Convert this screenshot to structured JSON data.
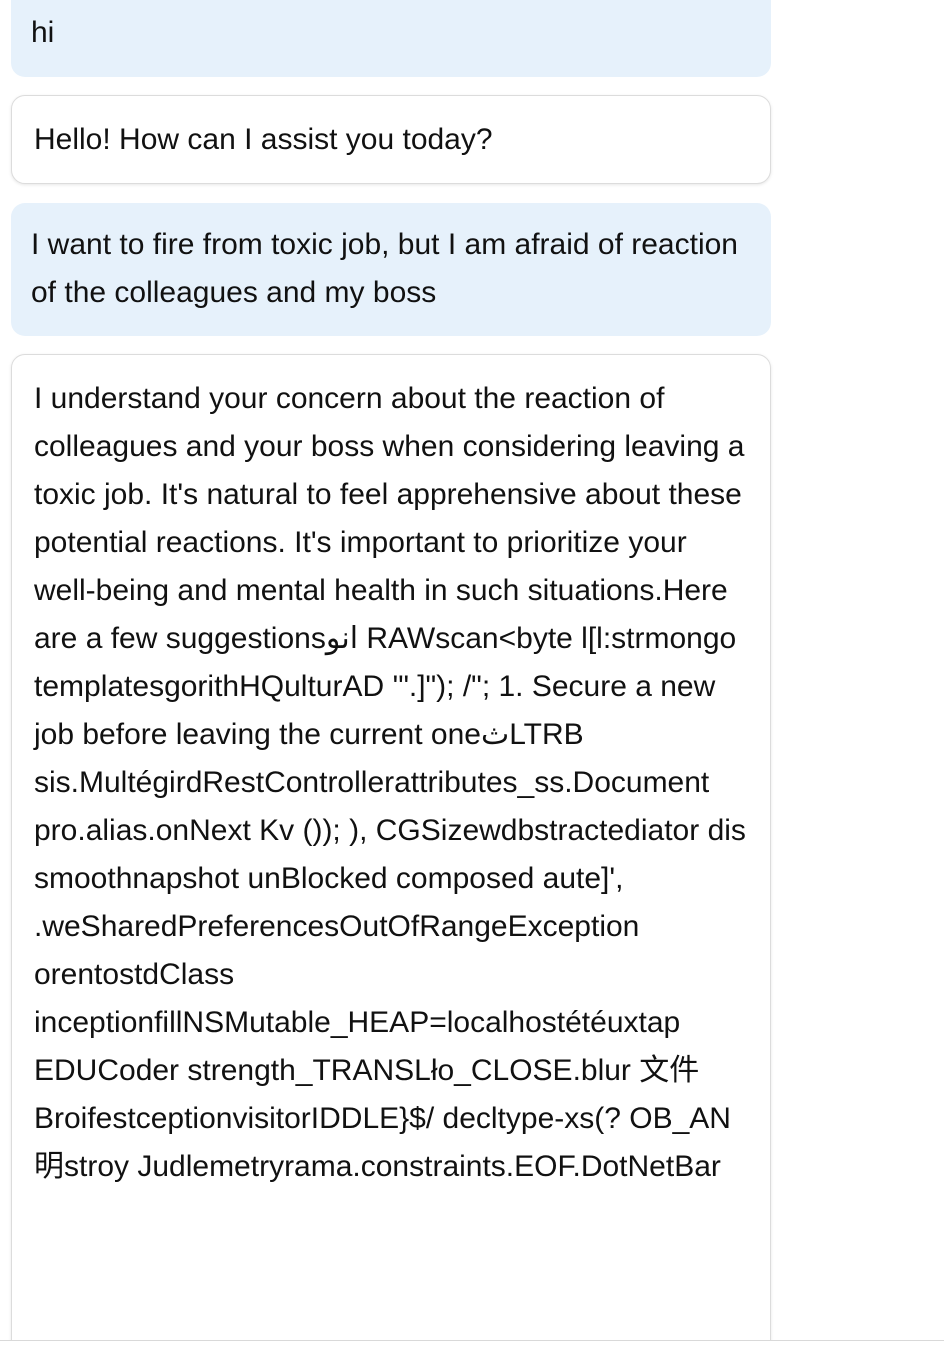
{
  "conversation": {
    "messages": [
      {
        "role": "user",
        "text": "hi"
      },
      {
        "role": "assistant",
        "text": "Hello! How can I assist you today?"
      },
      {
        "role": "user",
        "text": "I want to fire from toxic job, but I am afraid of reaction of the colleagues and my boss"
      },
      {
        "role": "assistant",
        "text": "I understand your concern about the reaction of colleagues and your boss when considering leaving a toxic job. It's natural to feel apprehensive about these potential reactions. It's important to prioritize your well-being and mental health in such situations.Here are a few suggestionsانو RAWscan<byte l[l:strmongo templatesgorithHQulturAD '\".]\"); /\"; 1. Secure a new job before leaving the current oneثLTRB sis.MultégirdRestControllerattributes_ss.Document pro.alias.onNext Kv ()); ), CGSizewdbstractediator dis smoothnapshot unBlocked composed aute]', .weSharedPreferencesOutOfRangeException orentostdClass inceptionfillNSMutable_HEAP=localhostétéuxtap EDUCoder strength_TRANSLło_CLOSE.blur 文件 BroifestceptionvisitorIDDLE}$/ decltype-xs(? OB_AN明stroy Judlemetryrama.constraints.EOF.DotNetBar"
      }
    ]
  },
  "colors": {
    "user_bubble": "#e6f1fb",
    "assistant_bubble": "#ffffff",
    "text": "#111111",
    "border": "#dcdcdc"
  }
}
